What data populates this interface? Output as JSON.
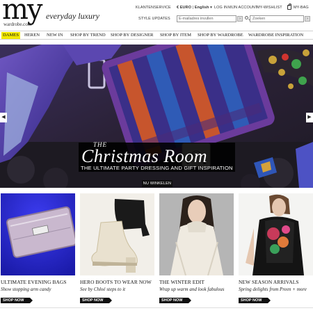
{
  "brand": {
    "logo_text": "my",
    "logo_subtext": "wardrobe.com",
    "tagline": "everyday luxury"
  },
  "header": {
    "customer_service": "KLANTENSERVICE",
    "currency": "€ EURO",
    "language": "English",
    "login": "LOG IN",
    "my_account": "MIJN ACCOUNT",
    "wishlist": "MY-WISHLIST",
    "bag": "MY-BAG",
    "style_updates": "STYLE UPDATES",
    "email_placeholder": "E-mailadres invullen",
    "search_placeholder": "Zoeken"
  },
  "nav": {
    "items": [
      {
        "label": "DAMES",
        "active": true
      },
      {
        "label": "HEREN"
      },
      {
        "label": "NEW IN"
      },
      {
        "label": "SHOP BY TREND"
      },
      {
        "label": "SHOP BY DESIGNER"
      },
      {
        "label": "SHOP BY ITEM"
      },
      {
        "label": "SHOP BY WARDROBE"
      },
      {
        "label": "WARDROBE INSPIRATION"
      }
    ]
  },
  "hero": {
    "kicker": "THE",
    "title": "Christmas Room",
    "subtitle": "THE ULTIMATE PARTY DRESSING AND GIFT INSPIRATION",
    "cta": "NU WINKELEN",
    "prev": "◀",
    "next": "▶"
  },
  "tiles": [
    {
      "title": "ULTIMATE EVENING BAGS",
      "desc": "Show stopping arm candy",
      "cta": "SHOP NOW"
    },
    {
      "title": "HERO BOOTS TO WEAR NOW",
      "desc": "See by Chloé steps to it",
      "cta": "SHOP NOW"
    },
    {
      "title": "THE WINTER EDIT",
      "desc": "Wrap up warm and look fabulous",
      "cta": "SHOP NOW"
    },
    {
      "title": "NEW SEASON ARRIVALS",
      "desc": "Spring delights from Preen + more",
      "cta": "SHOP NOW"
    }
  ],
  "colors": {
    "nav_active": "#f2e800",
    "accent_black": "#111111"
  }
}
